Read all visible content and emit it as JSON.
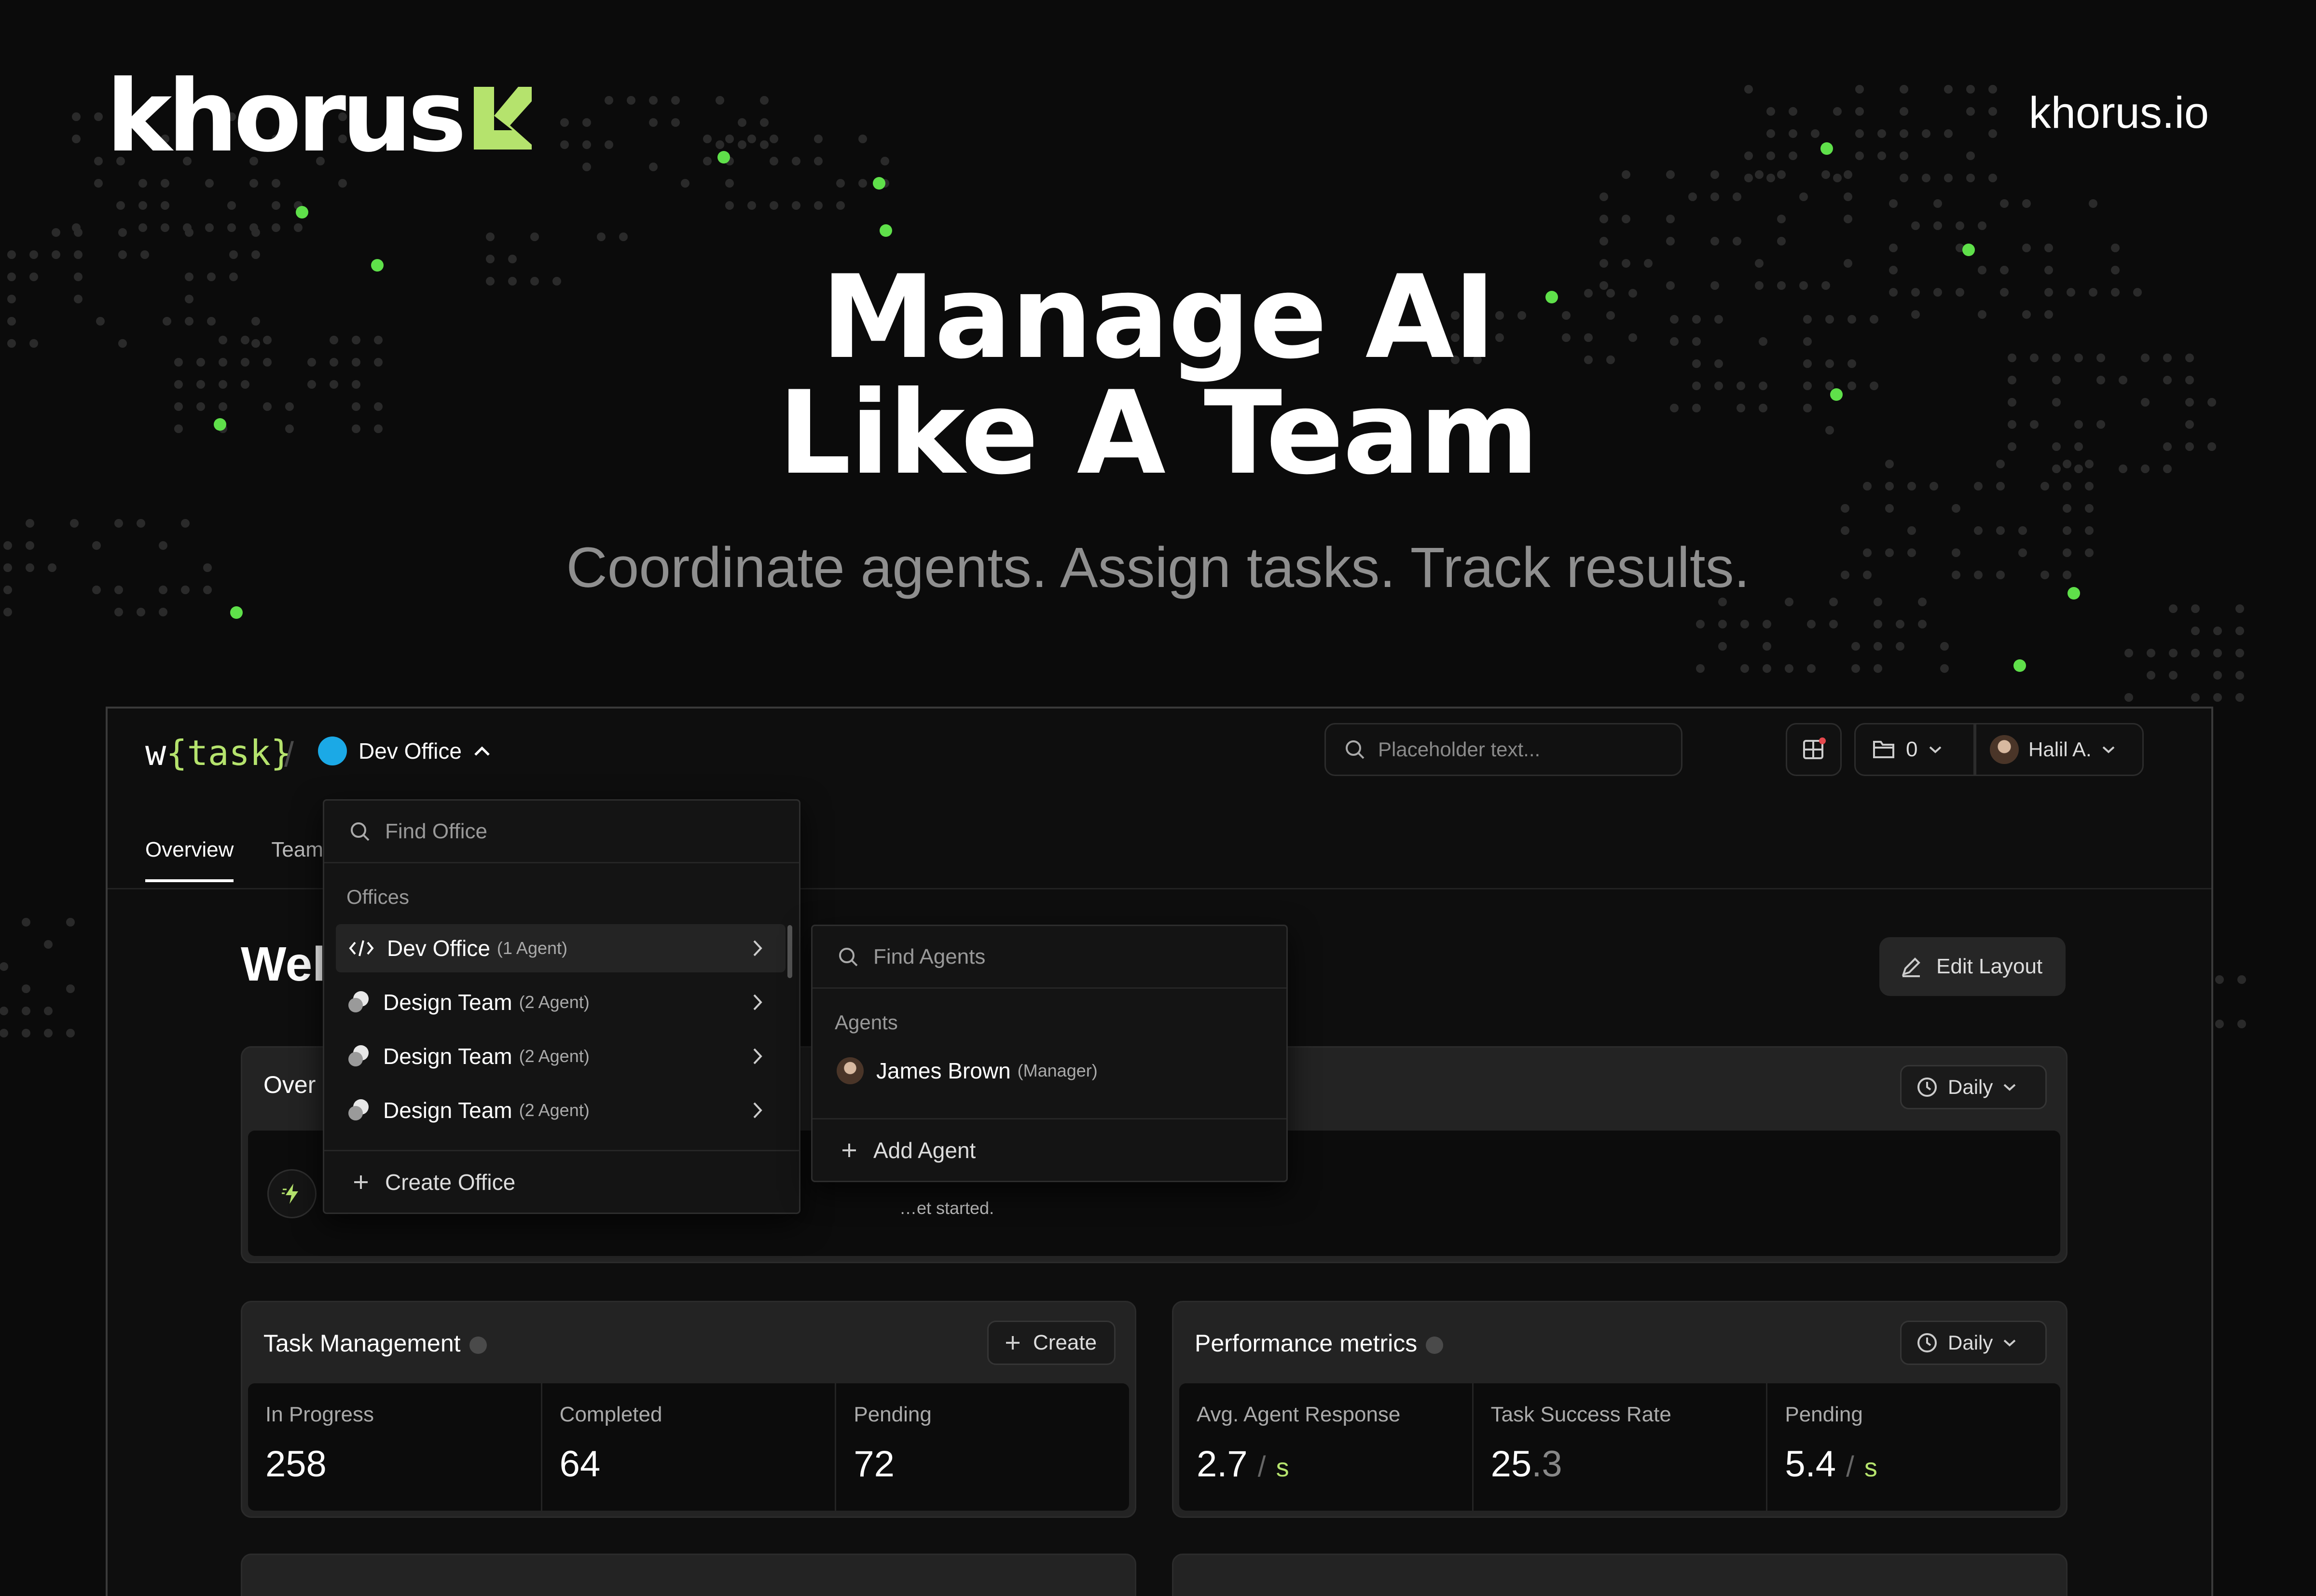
{
  "brand": {
    "logo_text": "khorus",
    "site_link": "khorus.io",
    "accent": "#b5e36d"
  },
  "hero": {
    "headline_line1": "Manage AI",
    "headline_line2": "Like A Team",
    "subline": "Coordinate agents. Assign tasks. Track results."
  },
  "app": {
    "brand_prefix": "w",
    "brand_core": "{task}",
    "breadcrumb_sep": "/",
    "current_office": "Dev Office",
    "office_color": "#1ba9e6",
    "search_placeholder": "Placeholder text...",
    "count_value": "0",
    "user_name": "Halil A.",
    "tabs": [
      {
        "label": "Overview",
        "active": true
      },
      {
        "label": "Team",
        "active": false
      }
    ],
    "welcome": "Wel",
    "edit_layout": "Edit Layout"
  },
  "office_dropdown": {
    "search_placeholder": "Find Office",
    "section_label": "Offices",
    "items": [
      {
        "icon": "code-icon",
        "label": "Dev Office",
        "sub": "(1 Agent)",
        "selected": true
      },
      {
        "icon": "team-icon",
        "label": "Design Team",
        "sub": "(2 Agent)",
        "selected": false
      },
      {
        "icon": "team-icon",
        "label": "Design Team",
        "sub": "(2 Agent)",
        "selected": false
      },
      {
        "icon": "team-icon",
        "label": "Design Team",
        "sub": "(2 Agent)",
        "selected": false
      }
    ],
    "create_label": "Create Office"
  },
  "agents_dropdown": {
    "search_placeholder": "Find Agents",
    "section_label": "Agents",
    "agents": [
      {
        "name": "James Brown",
        "role": "(Manager)"
      }
    ],
    "add_label": "Add Agent"
  },
  "overview_panel": {
    "title": "Over",
    "period": "Daily",
    "partial_text": "…et started."
  },
  "task_panel": {
    "title": "Task Management",
    "create_label": "Create",
    "metrics": [
      {
        "label": "In Progress",
        "value": "258"
      },
      {
        "label": "Completed",
        "value": "64"
      },
      {
        "label": "Pending",
        "value": "72"
      }
    ]
  },
  "perf_panel": {
    "title": "Performance metrics",
    "period": "Daily",
    "metrics": [
      {
        "label": "Avg. Agent Response",
        "value": "2.7",
        "unit_sep": "/",
        "unit": "s"
      },
      {
        "label": "Task Success Rate",
        "value": "25",
        "dim": ".3"
      },
      {
        "label": "Pending",
        "value": "5.4",
        "unit_sep": "/",
        "unit": "s"
      }
    ]
  }
}
